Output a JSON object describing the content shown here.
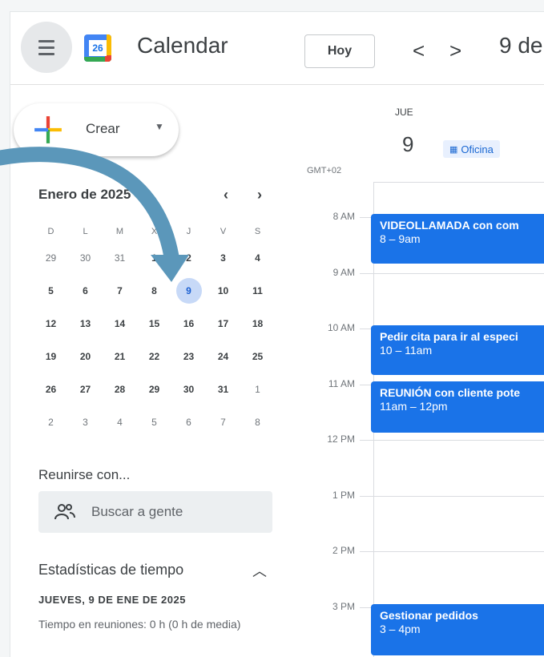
{
  "header": {
    "app_title": "Calendar",
    "logo_number": "26",
    "today_label": "Hoy",
    "prev_symbol": "<",
    "next_symbol": ">",
    "date_label": "9 de"
  },
  "sidebar": {
    "create_label": "Crear",
    "month_title": "Enero de 2025",
    "weekdays": [
      "D",
      "L",
      "M",
      "X",
      "J",
      "V",
      "S"
    ],
    "weeks": [
      [
        "29",
        "30",
        "31",
        "1",
        "2",
        "3",
        "4"
      ],
      [
        "5",
        "6",
        "7",
        "8",
        "9",
        "10",
        "11"
      ],
      [
        "12",
        "13",
        "14",
        "15",
        "16",
        "17",
        "18"
      ],
      [
        "19",
        "20",
        "21",
        "22",
        "23",
        "24",
        "25"
      ],
      [
        "26",
        "27",
        "28",
        "29",
        "30",
        "31",
        "1"
      ],
      [
        "2",
        "3",
        "4",
        "5",
        "6",
        "7",
        "8"
      ]
    ],
    "selected_day": "9",
    "meet_title": "Reunirse con...",
    "search_placeholder": "Buscar a gente",
    "stats_title": "Estadísticas de tiempo",
    "stats_date": "JUEVES, 9 DE ENE DE 2025",
    "stats_text": "Tiempo en reuniones: 0 h (0 h de media)"
  },
  "day_view": {
    "day_name": "JUE",
    "day_number": "9",
    "location": "Oficina",
    "timezone": "GMT+02",
    "hours": [
      "8 AM",
      "9 AM",
      "10 AM",
      "11 AM",
      "12 PM",
      "1 PM",
      "2 PM",
      "3 PM"
    ],
    "events": [
      {
        "title": "VIDEOLLAMADA con com",
        "time": "8 – 9am"
      },
      {
        "title": "Pedir cita para ir al especi",
        "time": "10 – 11am"
      },
      {
        "title": "REUNIÓN con cliente pote",
        "time": "11am – 12pm"
      },
      {
        "title": "Gestionar pedidos",
        "time": "3 – 4pm"
      }
    ]
  },
  "colors": {
    "accent": "#1a73e8",
    "selected_day_bg": "#c7d9f7",
    "arrow": "#5b97ba"
  }
}
